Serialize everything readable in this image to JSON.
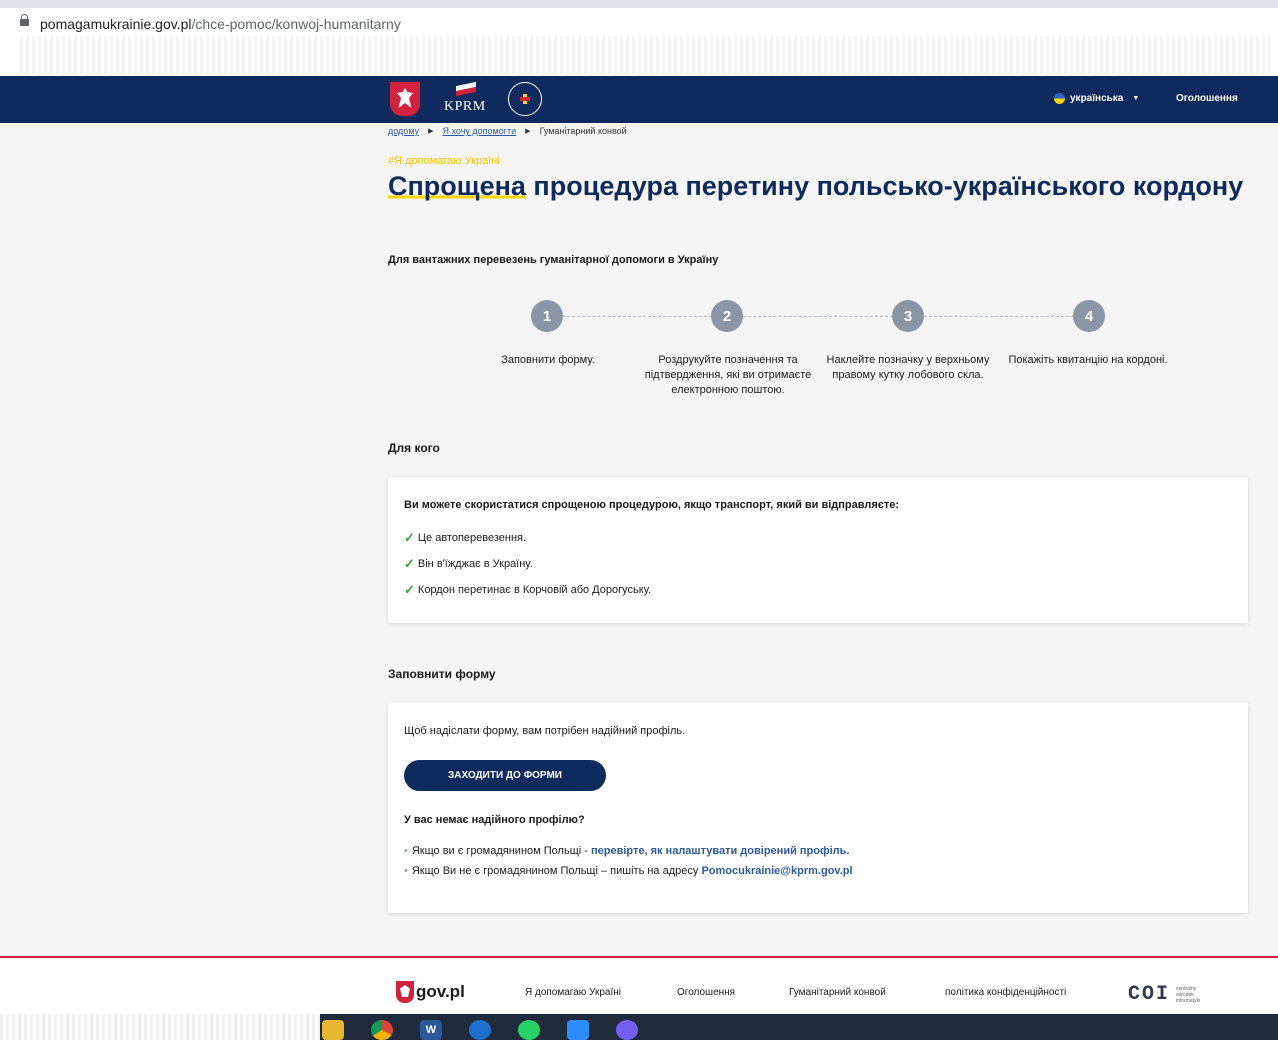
{
  "browser": {
    "url_host": "pomagamukrainie.gov.pl",
    "url_path": "/chce-pomoc/konwoj-humanitarny"
  },
  "header": {
    "kprm_label": "KPRM",
    "language": "українська",
    "announcements": "Оголошення"
  },
  "breadcrumb": [
    "додому",
    "Я хочу допомогти",
    "Гуманітарний конвой"
  ],
  "hashtag": "#Я допомагаю Україні",
  "title_highlight": "Спрощена",
  "title_rest": " процедура перетину польсько-українського кордону",
  "subtitle": "Для вантажних перевезень гуманітарної допомоги в Україну",
  "steps": [
    {
      "number": "1",
      "text": "Заповнити форму."
    },
    {
      "number": "2",
      "text": "Роздрукуйте позначення та підтвердження, які ви отримаєте електронною поштою."
    },
    {
      "number": "3",
      "text": "Наклейте позначку у верхньому правому кутку лобового скла."
    },
    {
      "number": "4",
      "text": "Покажіть квитанцію на кордоні."
    }
  ],
  "for_whom": {
    "heading": "Для кого",
    "lead": "Ви можете скористатися спрощеною процедурою, якщо транспорт, який ви відправляєте:",
    "items": [
      "Це автоперевезення.",
      "Він в'їжджає в Україну.",
      "Кордон перетинає в Корчовій або Дорогуську."
    ]
  },
  "form": {
    "heading": "Заповнити форму",
    "note": "Щоб надіслати форму, вам потрібен надійний профіль.",
    "button": "ЗАХОДИТИ ДО ФОРМИ",
    "no_profile_q": "У вас немає надійного профілю?",
    "bullet1_text": "Якщо ви є громадянином Польщі - ",
    "bullet1_link": "перевірте, як налаштувати довірений профіль.",
    "bullet2_text": "Якщо Ви не є громадянином Польщі – пишіть на адресу ",
    "bullet2_link": "Pomocukrainie@kprm.gov.pl"
  },
  "footer": {
    "gov": "gov.pl",
    "links": [
      "Я допомагаю Україні",
      "Оголошення",
      "Гуманітарний конвой",
      "політика конфіденційності"
    ],
    "coi": "COI",
    "coi_sub": [
      "centralny",
      "ośrodek",
      "informatyki"
    ]
  },
  "colors": {
    "navy": "#0f2a5c",
    "accent_yellow": "#ffd500",
    "red": "#d4213d",
    "check_green": "#3aa346"
  },
  "taskbar_icons": [
    "folder-icon",
    "chrome-icon",
    "word-icon",
    "thunderbird-icon",
    "whatsapp-icon",
    "zoom-icon",
    "viber-icon"
  ]
}
